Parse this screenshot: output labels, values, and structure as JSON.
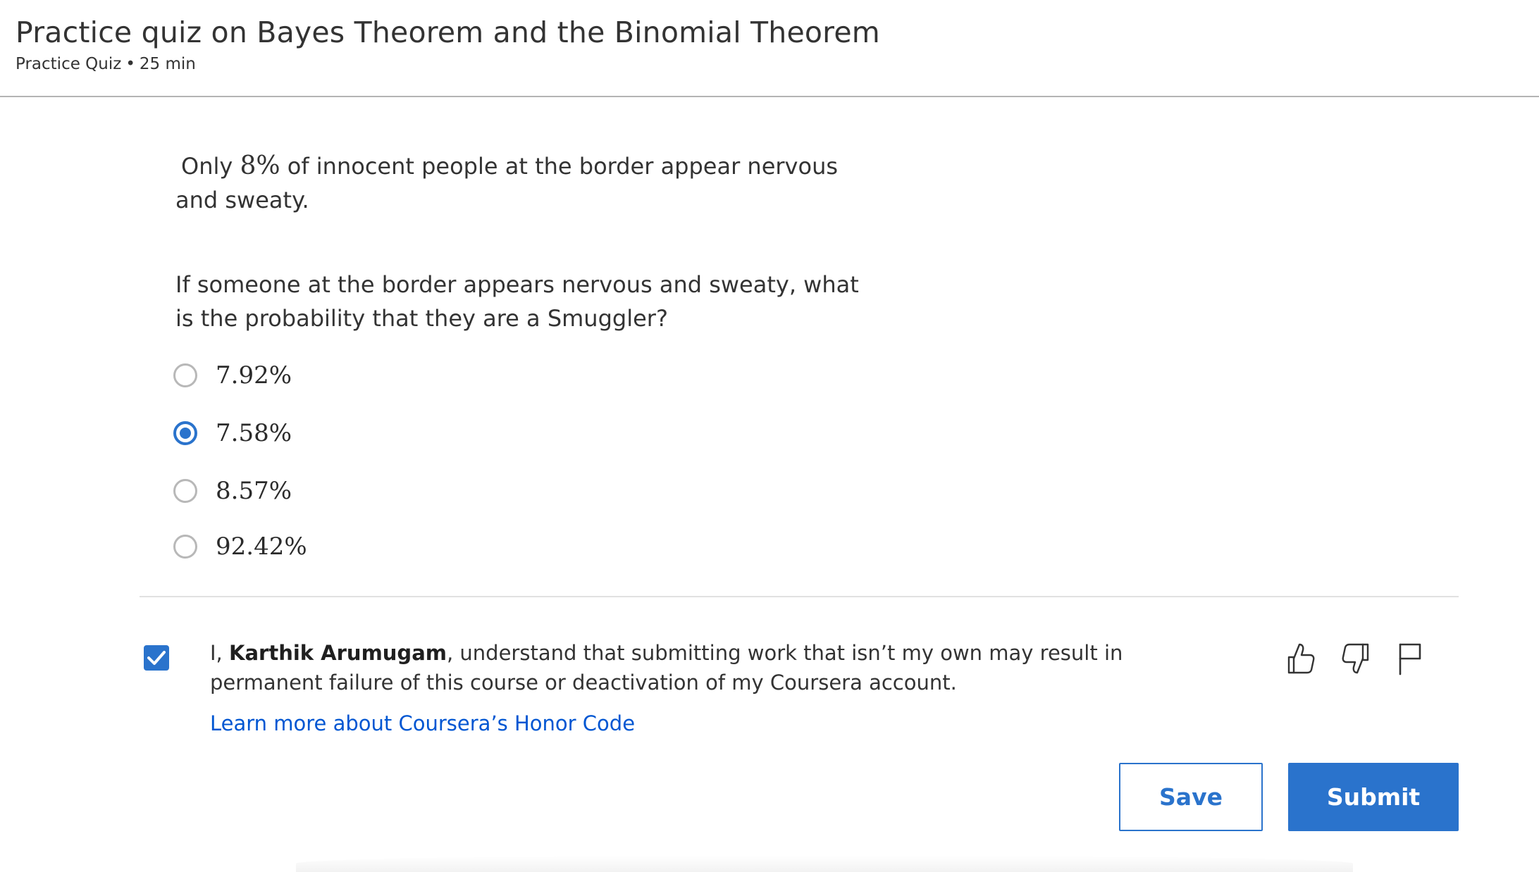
{
  "header": {
    "title": "Practice quiz on Bayes Theorem and the Binomial Theorem",
    "type": "Practice Quiz",
    "separator": "•",
    "duration": "25 min"
  },
  "question": {
    "line1_prefix": "Only ",
    "line1_math": "8%",
    "line1_suffix": " of innocent people at the border appear nervous and sweaty.",
    "prompt": "If someone at the border appears nervous and sweaty, what is the probability that they are a Smuggler?",
    "options": [
      {
        "label": "7.92%",
        "selected": false
      },
      {
        "label": "7.58%",
        "selected": true
      },
      {
        "label": "8.57%",
        "selected": false
      },
      {
        "label": "92.42%",
        "selected": false
      }
    ]
  },
  "honor": {
    "checked": true,
    "prefix": "I, ",
    "name": "Karthik Arumugam",
    "suffix": ", understand that submitting work that isn’t my own may result in permanent failure of this course or deactivation of my Coursera account.",
    "link": "Learn more about Coursera’s Honor Code"
  },
  "feedback_icons": [
    "thumbs-up-icon",
    "thumbs-down-icon",
    "flag-icon"
  ],
  "actions": {
    "save_label": "Save",
    "submit_label": "Submit"
  },
  "colors": {
    "accent": "#2a73cc",
    "link": "#0056d2",
    "text": "#333333"
  }
}
